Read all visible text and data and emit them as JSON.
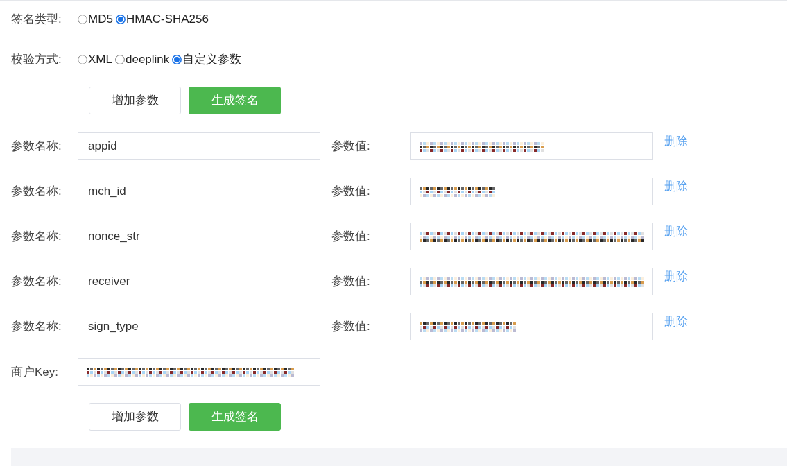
{
  "sign_type": {
    "label": "签名类型:",
    "options": [
      {
        "label": "MD5",
        "selected": false
      },
      {
        "label": "HMAC-SHA256",
        "selected": true
      }
    ]
  },
  "verify_method": {
    "label": "校验方式:",
    "options": [
      {
        "label": "XML",
        "selected": false
      },
      {
        "label": "deeplink",
        "selected": false
      },
      {
        "label": "自定义参数",
        "selected": true
      }
    ]
  },
  "buttons_top": [
    "增加参数",
    "生成签名"
  ],
  "params": [
    {
      "name_label": "参数名称:",
      "name": "appid",
      "value_label": "参数值:",
      "delete": "删除"
    },
    {
      "name_label": "参数名称:",
      "name": "mch_id",
      "value_label": "参数值:",
      "delete": "删除"
    },
    {
      "name_label": "参数名称:",
      "name": "nonce_str",
      "value_label": "参数值:",
      "delete": "删除"
    },
    {
      "name_label": "参数名称:",
      "name": "receiver",
      "value_label": "参数值:",
      "delete": "删除"
    },
    {
      "name_label": "参数名称:",
      "name": "sign_type",
      "value_label": "参数值:",
      "delete": "删除"
    }
  ],
  "merchant_key": {
    "label": "商户Key:"
  },
  "buttons_bottom": [
    "增加参数",
    "生成签名"
  ]
}
